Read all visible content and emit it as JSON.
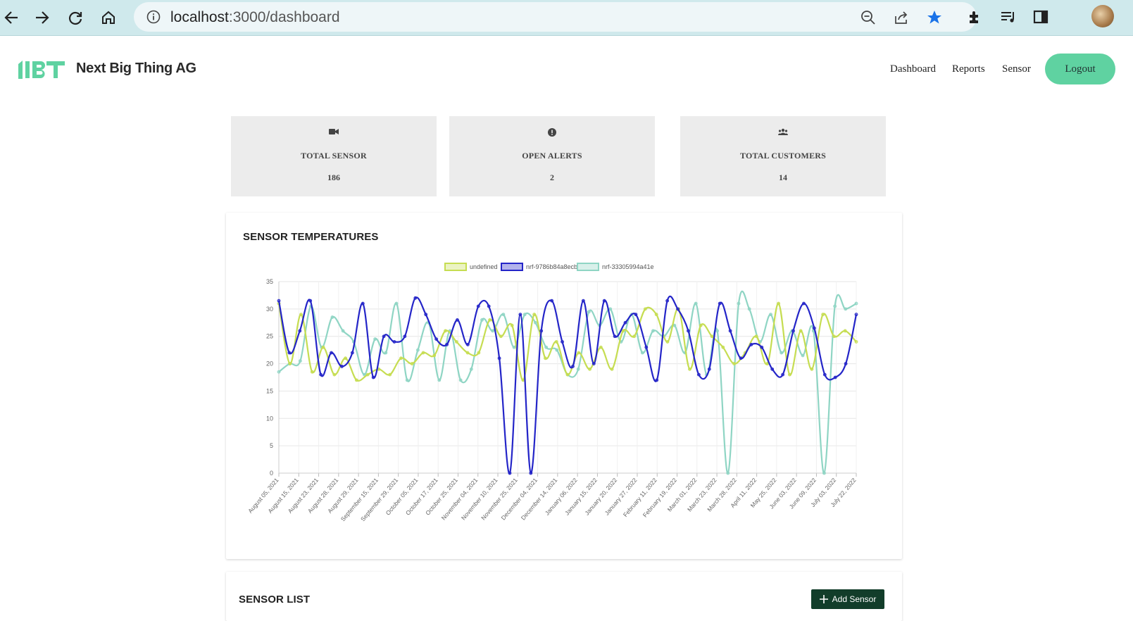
{
  "browser": {
    "url_host": "localhost",
    "url_path": ":3000/dashboard"
  },
  "app": {
    "brand": "Next Big Thing AG",
    "nav": [
      "Dashboard",
      "Reports",
      "Sensor"
    ],
    "logout": "Logout"
  },
  "stats": [
    {
      "icon": "video-camera-icon",
      "label": "TOTAL SENSOR",
      "value": "186"
    },
    {
      "icon": "alert-circle-icon",
      "label": "OPEN ALERTS",
      "value": "2"
    },
    {
      "icon": "users-icon",
      "label": "TOTAL CUSTOMERS",
      "value": "14"
    }
  ],
  "chart_section": {
    "title": "SENSOR TEMPERATURES"
  },
  "sensor_list": {
    "title": "SENSOR LIST",
    "add_button": "Add Sensor"
  },
  "colors": {
    "accent": "#5fd2a1",
    "dark_button": "#123d2a"
  },
  "chart_data": {
    "type": "line",
    "ylim": [
      0,
      35
    ],
    "yticks": [
      0,
      5,
      10,
      15,
      20,
      25,
      30,
      35
    ],
    "grid": true,
    "legend_position": "top",
    "categories": [
      "August 05, 2021",
      "August 15, 2021",
      "August 23, 2021",
      "August 28, 2021",
      "August 29, 2021",
      "September 15, 2021",
      "September 29, 2021",
      "October 05, 2021",
      "October 17, 2021",
      "October 25, 2021",
      "November 04, 2021",
      "November 10, 2021",
      "November 25, 2021",
      "December 04, 2021",
      "December 14, 2021",
      "January 06, 2022",
      "January 15, 2022",
      "January 20, 2022",
      "January 27, 2022",
      "February 11, 2022",
      "February 19, 2022",
      "March 01, 2022",
      "March 23, 2022",
      "March 28, 2022",
      "April 11, 2022",
      "May 25, 2022",
      "June 03, 2022",
      "June 09, 2022",
      "July 03, 2022",
      "July 22, 2022"
    ],
    "series": [
      {
        "name": "undefined",
        "color": "#c6dd52",
        "values": [
          31,
          20,
          29,
          18.5,
          23,
          18,
          21,
          17,
          18,
          19,
          18,
          21,
          20,
          22,
          21.5,
          26,
          24,
          22,
          22,
          28,
          25,
          27,
          17,
          29,
          21,
          24,
          18,
          22,
          19,
          23,
          19,
          26,
          25,
          30,
          29,
          24,
          30,
          19,
          27,
          25,
          23,
          20,
          22,
          25,
          20,
          31,
          18,
          26,
          19,
          29,
          25,
          26,
          24
        ]
      },
      {
        "name": "nrf-9786b84a8ecb",
        "color": "#2425c8",
        "values": [
          31.5,
          22,
          26,
          31.5,
          18,
          22,
          19.5,
          22,
          31,
          17.5,
          25,
          24,
          25,
          32,
          29,
          24.5,
          23.5,
          28,
          23.5,
          30.5,
          30.5,
          21,
          0,
          29,
          0,
          26,
          31.5,
          24,
          19.5,
          31.5,
          20,
          31.5,
          25,
          27.5,
          29,
          23,
          17,
          31.5,
          30,
          26,
          18,
          19,
          31,
          26,
          21,
          23.5,
          23,
          19,
          18,
          26,
          31,
          26.5,
          18,
          17.5,
          20,
          29
        ]
      },
      {
        "name": "nrf-33305994a41e",
        "color": "#8fd5c4",
        "values": [
          18.5,
          20,
          20.5,
          30.5,
          23,
          28.5,
          26,
          24,
          18,
          24.5,
          22,
          31,
          17,
          22.5,
          27.5,
          17,
          26,
          17,
          19,
          28,
          26,
          29,
          23,
          29,
          27.5,
          23,
          22.5,
          18,
          19,
          29.5,
          27,
          30,
          24,
          29,
          22,
          26,
          25,
          27,
          22,
          31,
          18,
          26,
          0,
          31,
          30,
          24,
          29,
          22,
          26,
          21.5,
          26,
          0,
          30.5,
          30,
          31
        ]
      }
    ]
  }
}
